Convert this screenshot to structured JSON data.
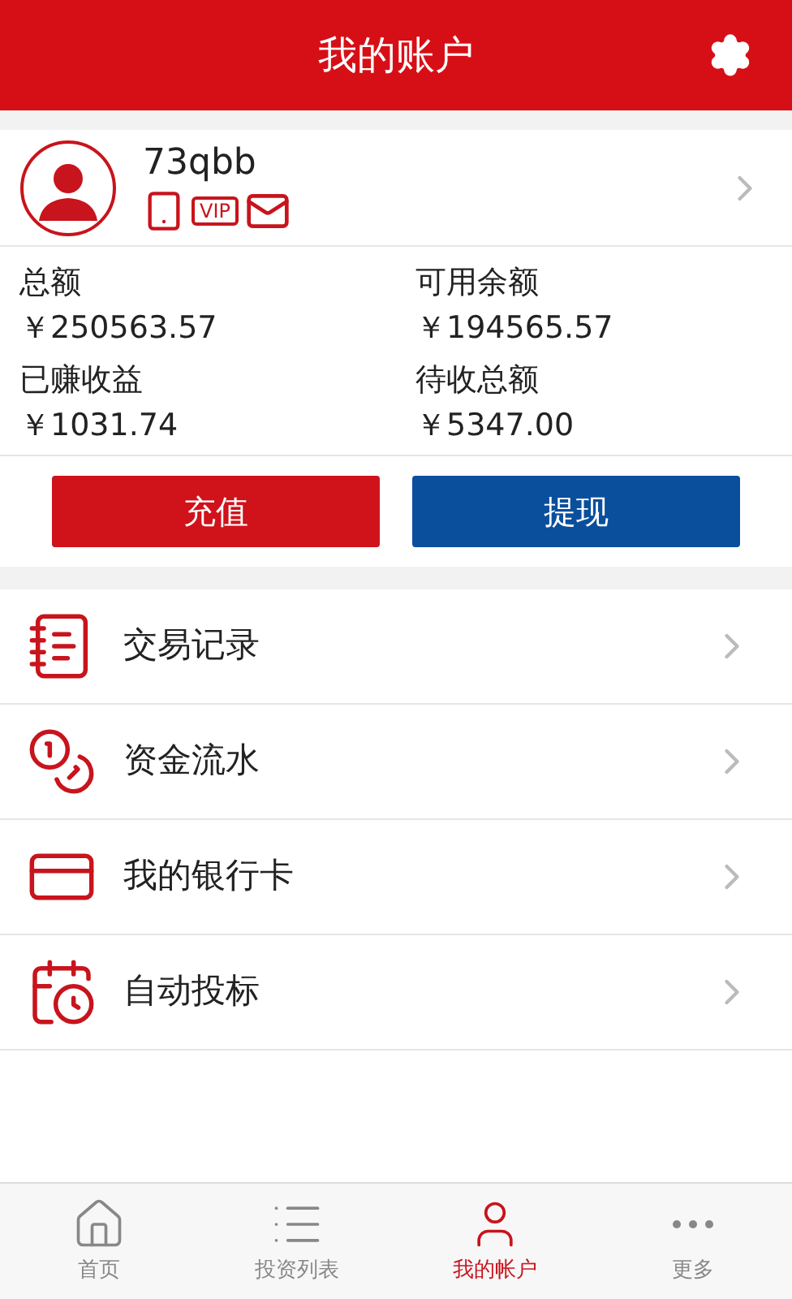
{
  "header": {
    "title": "我的账户"
  },
  "profile": {
    "username": "73qbb",
    "vip_badge": "VIP"
  },
  "stats": [
    {
      "label": "总额",
      "value": "￥250563.57"
    },
    {
      "label": "可用余额",
      "value": "￥194565.57"
    },
    {
      "label": "已赚收益",
      "value": "￥1031.74"
    },
    {
      "label": "待收总额",
      "value": "￥5347.00"
    }
  ],
  "actions": [
    {
      "label": "充值",
      "kind": "recharge"
    },
    {
      "label": "提现",
      "kind": "withdraw"
    }
  ],
  "menu": [
    {
      "label": "交易记录"
    },
    {
      "label": "资金流水"
    },
    {
      "label": "我的银行卡"
    },
    {
      "label": "自动投标"
    }
  ],
  "tabs": [
    {
      "label": "首页",
      "selected": false
    },
    {
      "label": "投资列表",
      "selected": false
    },
    {
      "label": "我的帐户",
      "selected": true
    },
    {
      "label": "更多",
      "selected": false
    }
  ]
}
